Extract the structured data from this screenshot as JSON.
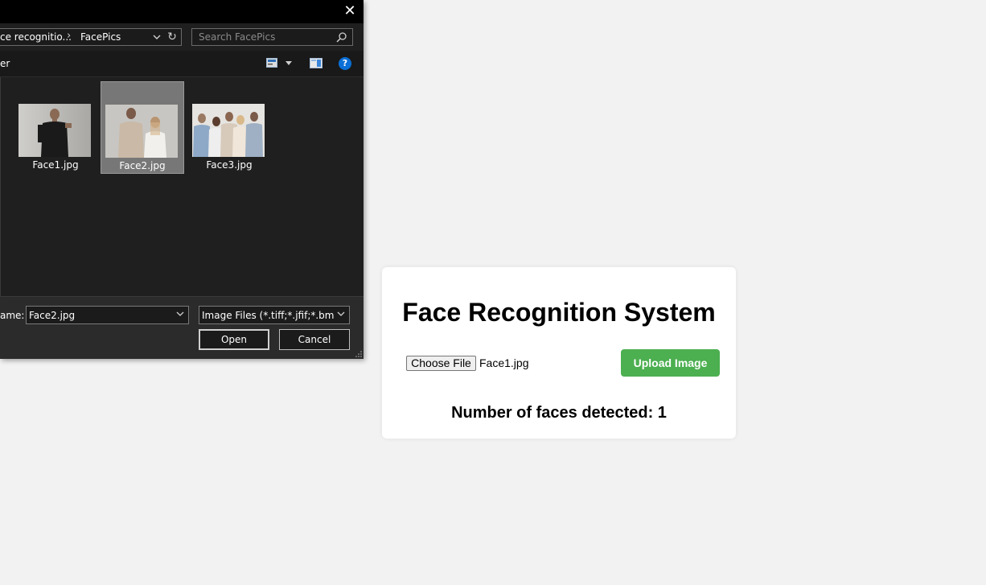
{
  "dialog": {
    "close_glyph": "✕",
    "address": {
      "crumb_parent": "ce recognitio...",
      "crumb_separator": "›",
      "crumb_current": "FacePics",
      "refresh_glyph": "↻"
    },
    "search": {
      "placeholder": "Search FacePics"
    },
    "toolbar": {
      "new_folder_label": "er",
      "help_glyph": "?"
    },
    "files": [
      {
        "name": "Face1.jpg",
        "selected": false
      },
      {
        "name": "Face2.jpg",
        "selected": true
      },
      {
        "name": "Face3.jpg",
        "selected": false
      }
    ],
    "filename_label": "ame:",
    "filename_value": "Face2.jpg",
    "filetype_value": "Image Files (*.tiff;*.jfif;*.bmp;*.gif",
    "open_label": "Open",
    "cancel_label": "Cancel",
    "colors": {
      "background": "#1f1f1f",
      "titlebar": "#000000",
      "selected": "#777777",
      "help": "#0a6fd6"
    }
  },
  "app": {
    "title": "Face Recognition System",
    "choose_file_label": "Choose File",
    "chosen_file_name": "Face1.jpg",
    "upload_label": "Upload Image",
    "result_text": "Number of faces detected: 1",
    "colors": {
      "page_bg": "#f2f2f2",
      "card_bg": "#ffffff",
      "upload_button": "#4caf50"
    }
  }
}
